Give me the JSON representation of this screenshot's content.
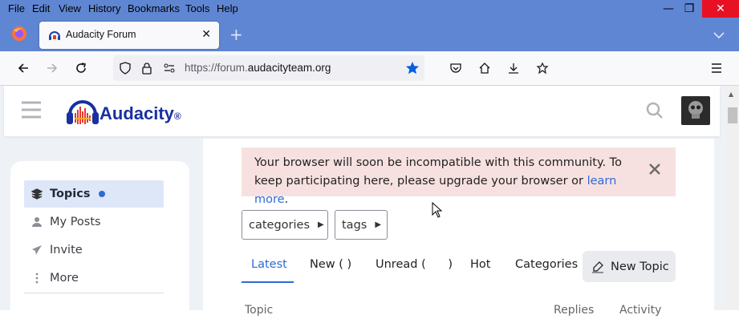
{
  "menu": [
    "File",
    "Edit",
    "View",
    "History",
    "Bookmarks",
    "Tools",
    "Help"
  ],
  "window_controls": {
    "minimize": "—",
    "restore": "❐",
    "close": "✕"
  },
  "tab": {
    "title": "Audacity Forum",
    "close": "✕",
    "new_tab": "+"
  },
  "url": {
    "prefix": "https://forum.",
    "domain": "audacityteam.org"
  },
  "site": {
    "logo_text": "Audacity",
    "logo_mark": "®"
  },
  "sidebar": {
    "items": [
      {
        "label": "Topics",
        "icon": "layers-icon"
      },
      {
        "label": "My Posts",
        "icon": "user-icon"
      },
      {
        "label": "Invite",
        "icon": "paper-plane-icon"
      },
      {
        "label": "More",
        "icon": "vertical-dots-icon"
      }
    ]
  },
  "alert": {
    "text": "Your browser will soon be incompatible with this community. To keep participating here, please upgrade your browser or ",
    "link": "learn more",
    "tail": ".",
    "close": "✕"
  },
  "filters": {
    "categories": "categories",
    "tags": "tags"
  },
  "nav_tabs": {
    "latest": "Latest",
    "new": "New ( )",
    "unread": "Unread (      )",
    "hot": "Hot",
    "categories": "Categories"
  },
  "new_topic": "New Topic",
  "list_header": {
    "topic": "Topic",
    "replies": "Replies",
    "activity": "Activity"
  },
  "colors": {
    "browser_chrome": "#5f86d3",
    "accent": "#2f6ad3",
    "alert_bg": "#f7e1e0"
  }
}
